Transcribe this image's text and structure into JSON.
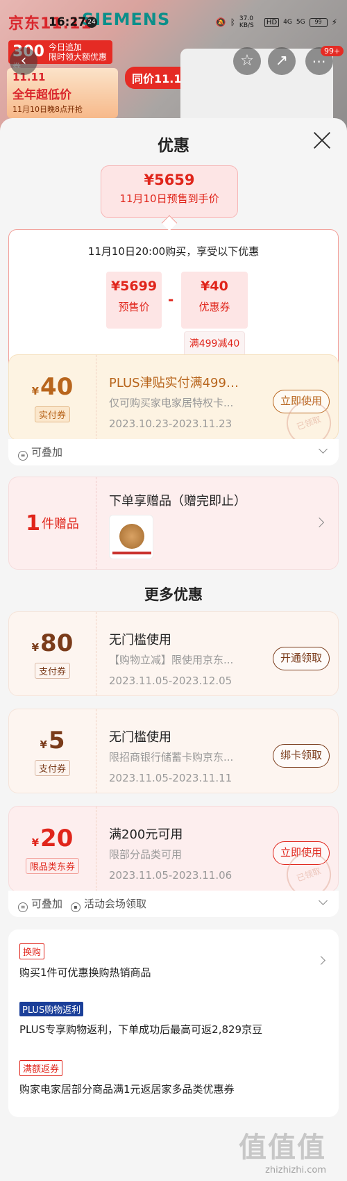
{
  "status_bar": {
    "time": "16:27",
    "notif_count": "24",
    "net_speed": "37.0 KB/S",
    "hd": "HD",
    "signal1": "4G",
    "signal2": "5G",
    "battery": "99"
  },
  "banner": {
    "brand": "京东11.11",
    "brand2": "SIEMENS",
    "promo_amount": "300",
    "promo_line1": "今日追加",
    "promo_line2": "限时领大额优惠券",
    "promo_headline": "11.11",
    "promo_main": "全年超低价",
    "promo_sub": "11月10日晚8点开抢",
    "tag": "同价11.11",
    "more_count": "99+"
  },
  "sheet": {
    "title": "优惠",
    "price": {
      "amount": "¥5659",
      "label": "11月10日预售到手价"
    },
    "calc": {
      "head": "11月10日20:00购买，享受以下优惠",
      "presale_value": "¥5699",
      "presale_label": "预售价",
      "coupon_value": "¥40",
      "coupon_label": "优惠券",
      "minus": "-",
      "coupon_note": "满499减40"
    },
    "coupon1": {
      "yen": "¥",
      "amount": "40",
      "type": "实付券",
      "title": "PLUS津贴实付满499元...",
      "desc": "仅可购买家电家居特权卡...",
      "date": "2023.10.23-2023.11.23",
      "button": "立即使用",
      "stamp": "已领取",
      "footer": "可叠加"
    },
    "gift": {
      "count": "1",
      "unit": "件赠品",
      "title": "下单享赠品（赠完即止）"
    },
    "more_title": "更多优惠",
    "coupon2": {
      "yen": "¥",
      "amount": "80",
      "type": "支付券",
      "title": "无门槛使用",
      "desc": "【购物立减】限使用京东...",
      "date": "2023.11.05-2023.12.05",
      "button": "开通领取"
    },
    "coupon3": {
      "yen": "¥",
      "amount": "5",
      "type": "支付券",
      "title": "无门槛使用",
      "desc": "限招商银行储蓄卡购京东...",
      "date": "2023.11.05-2023.11.11",
      "button": "绑卡领取"
    },
    "coupon4": {
      "yen": "¥",
      "amount": "20",
      "type": "限品类东券",
      "title": "满200元可用",
      "desc": "限部分品类可用",
      "date": "2023.11.05-2023.11.06",
      "button": "立即使用",
      "stamp": "已领取",
      "footer1": "可叠加",
      "footer2": "活动会场领取"
    },
    "list": [
      {
        "tag": "换购",
        "text": "购买1件可优惠换购热销商品"
      },
      {
        "tag": "PLUS购物返利",
        "text": "PLUS专享购物返利，下单成功后最高可返2,829京豆"
      },
      {
        "tag": "满额返券",
        "text": "购家电家居部分商品满1元返居家多品类优惠券"
      }
    ]
  },
  "watermark": {
    "mark": "值值值",
    "url": "zhizhizhi.com"
  },
  "colors": {
    "accent_red": "#e0251b",
    "gold": "#b8651c",
    "plus_blue": "#1b3f99"
  }
}
